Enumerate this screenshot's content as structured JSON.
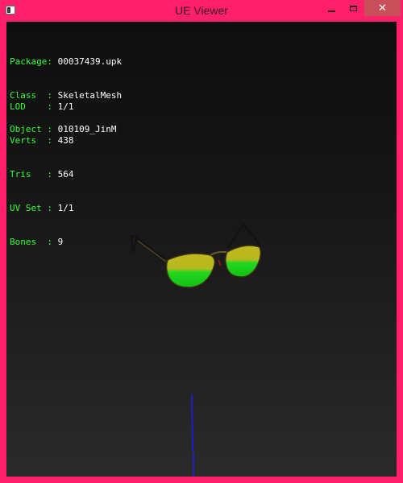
{
  "window": {
    "title": "UE Viewer",
    "controls": {
      "minimize_icon": "minimize-icon",
      "maximize_icon": "maximize-icon",
      "close_glyph": "✕"
    }
  },
  "info_block_1": [
    {
      "label": "Package:",
      "value": "00037439.upk"
    },
    {
      "label": "Class  :",
      "value": "SkeletalMesh"
    },
    {
      "label": "Object :",
      "value": "010109_JinM"
    }
  ],
  "info_block_2": [
    {
      "label": "LOD    :",
      "value": "1/1"
    },
    {
      "label": "Verts  :",
      "value": "438"
    },
    {
      "label": "Tris   :",
      "value": "564"
    },
    {
      "label": "UV Set :",
      "value": "1/1"
    },
    {
      "label": "Bones  :",
      "value": "9"
    }
  ],
  "colors": {
    "window_frame": "#ff1f6b",
    "label_text": "#33ff33",
    "value_text": "#ffffff",
    "close_button": "#c7505b",
    "axis_line": "#1a1aff",
    "lens_top": "#b8b820",
    "lens_bottom": "#18e018"
  }
}
